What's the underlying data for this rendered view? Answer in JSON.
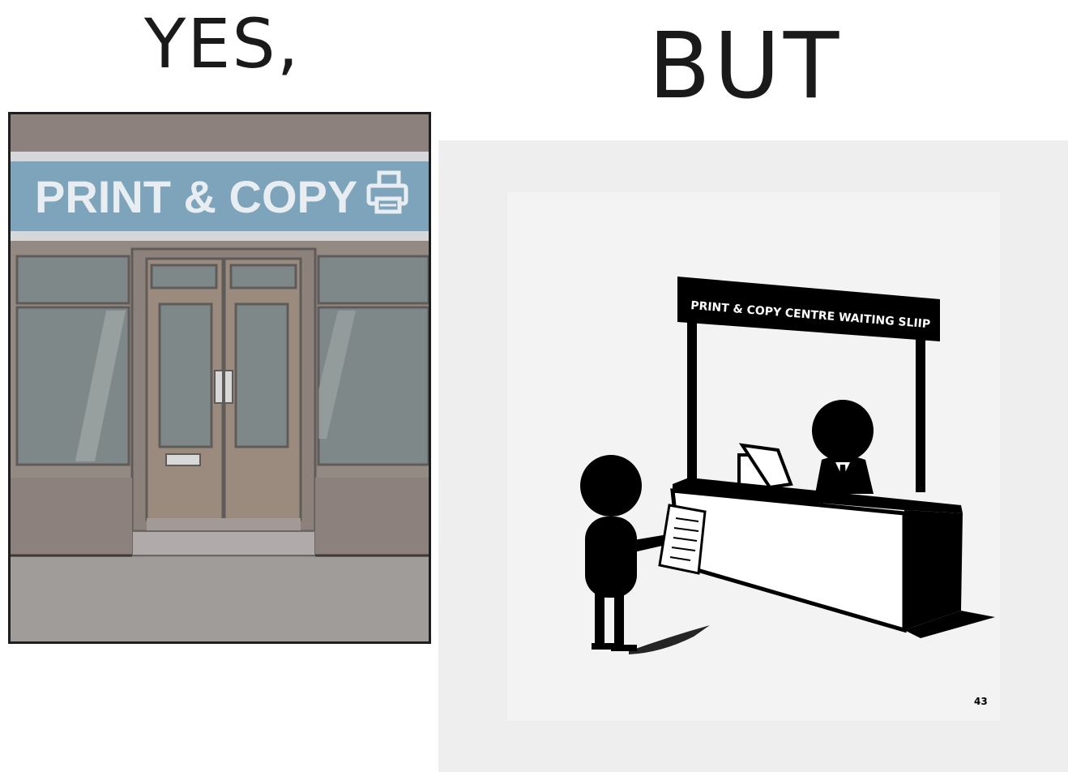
{
  "headings": {
    "yes": "YES,",
    "but": "BUT"
  },
  "storefront": {
    "sign_text": "PRINT & COPY",
    "sign_icon": "printer-icon",
    "colors": {
      "sign": "#7ea4bb",
      "wall": "#948a84",
      "glass": "#7f8888",
      "door": "#9a8b7e"
    }
  },
  "counter_scene": {
    "banner_text": "PRINT & COPY CENTRE WAITING SLIIP",
    "page_number": "43"
  }
}
